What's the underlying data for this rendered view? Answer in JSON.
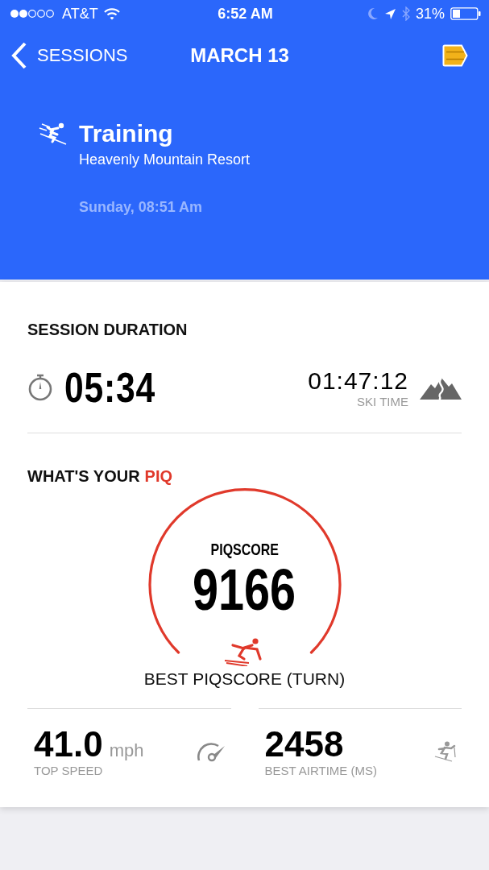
{
  "status_bar": {
    "carrier": "AT&T",
    "time": "6:52 AM",
    "battery": "31%"
  },
  "nav": {
    "back": "SESSIONS",
    "title": "MARCH 13"
  },
  "session": {
    "type": "Training",
    "location": "Heavenly Mountain Resort",
    "datetime": "Sunday, 08:51 Am"
  },
  "duration": {
    "heading": "SESSION DURATION",
    "value": "05:34",
    "ski_time": "01:47:12",
    "ski_time_label": "SKI TIME"
  },
  "piq": {
    "heading": "WHAT'S YOUR",
    "heading_accent": "PIQ",
    "score_label": "PIQSCORE",
    "score": "9166",
    "caption": "BEST PIQSCORE (TURN)"
  },
  "stats": [
    {
      "kind": "speed",
      "value": "41.0",
      "unit": "mph",
      "label": "TOP SPEED"
    },
    {
      "kind": "airtime",
      "value": "2458",
      "label": "BEST AIRTIME (MS)"
    }
  ]
}
